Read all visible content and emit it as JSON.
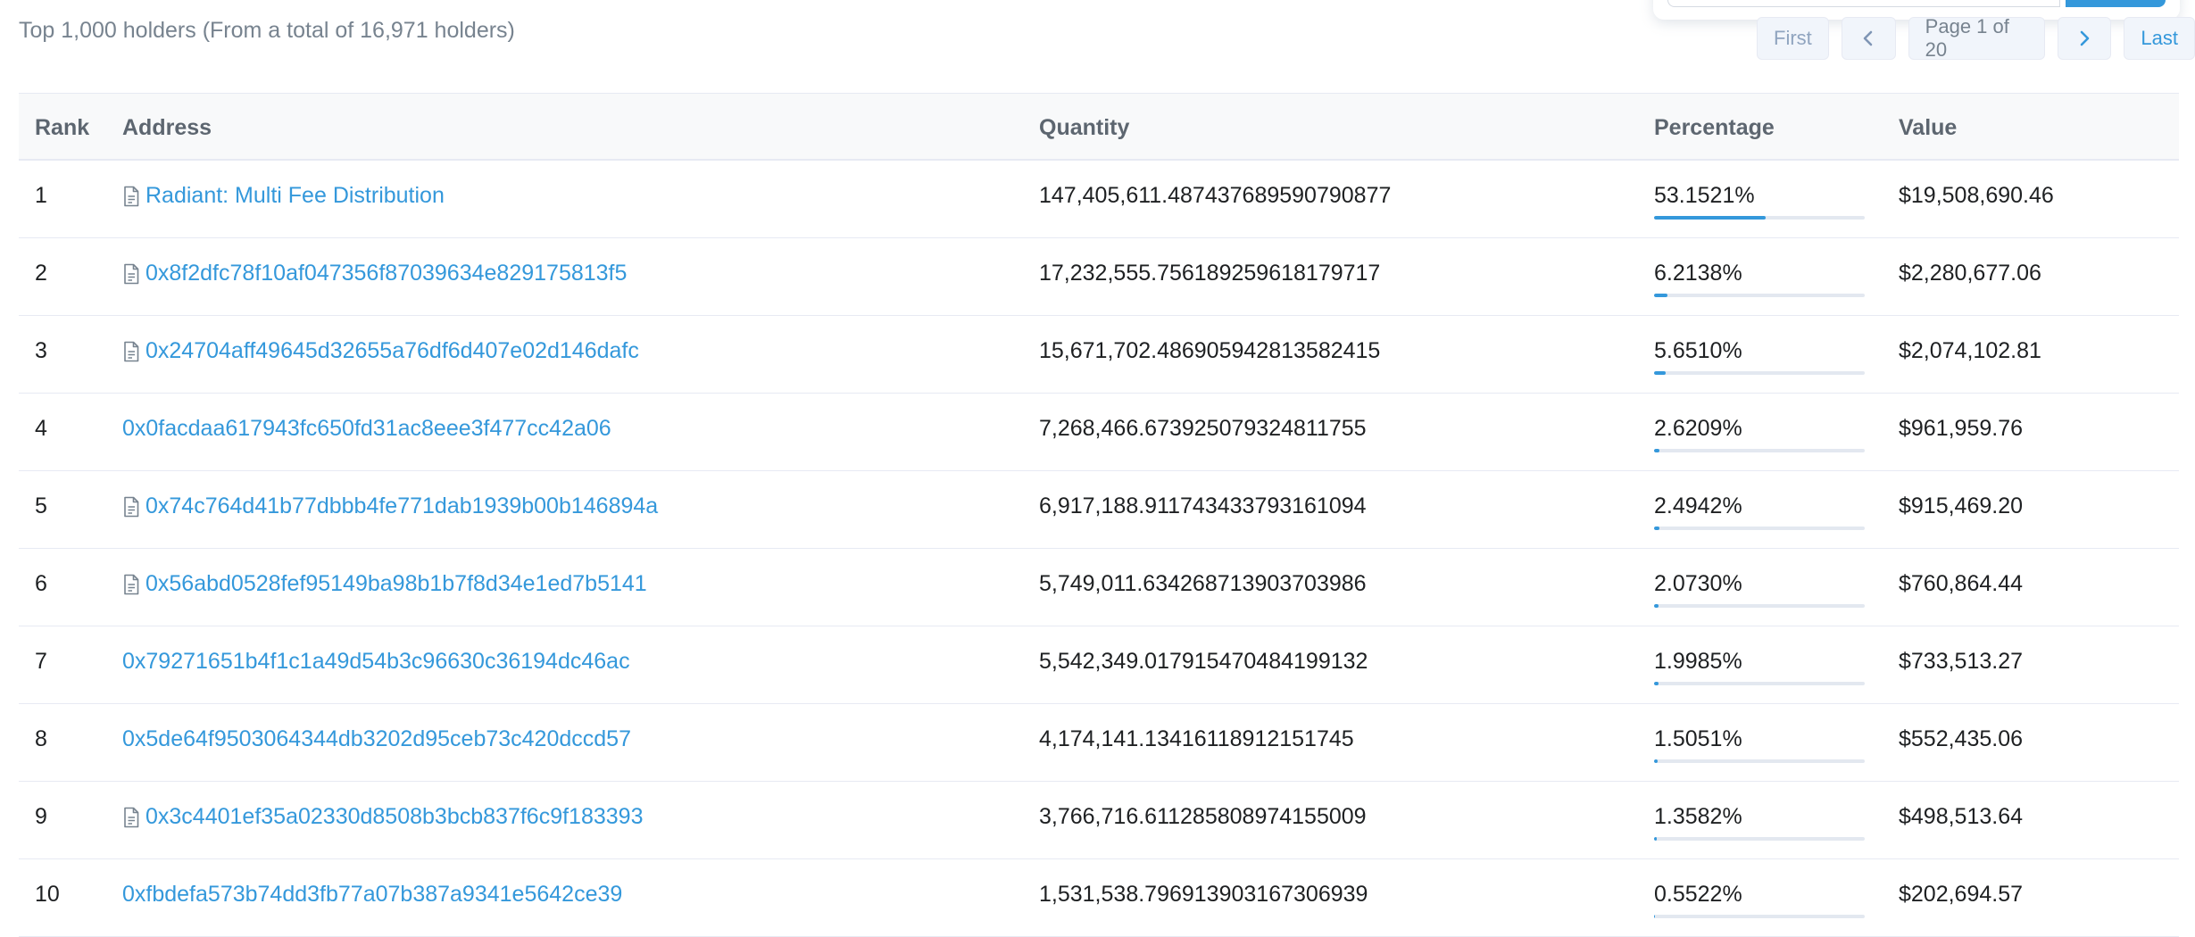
{
  "summary": "Top 1,000 holders (From a total of 16,971 holders)",
  "pager": {
    "first": "First",
    "page": "Page 1 of 20",
    "last": "Last"
  },
  "colors": {
    "accent": "#3498db",
    "track": "#e3e8f0",
    "muted": "#77838f"
  },
  "table": {
    "headers": {
      "rank": "Rank",
      "address": "Address",
      "quantity": "Quantity",
      "percentage": "Percentage",
      "value": "Value"
    },
    "rows": [
      {
        "rank": "1",
        "address": "Radiant: Multi Fee Distribution",
        "contract": true,
        "quantity": "147,405,611.487437689590790877",
        "percentage": "53.1521%",
        "pct_value": 53.1521,
        "value": "$19,508,690.46"
      },
      {
        "rank": "2",
        "address": "0x8f2dfc78f10af047356f87039634e829175813f5",
        "contract": true,
        "quantity": "17,232,555.756189259618179717",
        "percentage": "6.2138%",
        "pct_value": 6.2138,
        "value": "$2,280,677.06"
      },
      {
        "rank": "3",
        "address": "0x24704aff49645d32655a76df6d407e02d146dafc",
        "contract": true,
        "quantity": "15,671,702.486905942813582415",
        "percentage": "5.6510%",
        "pct_value": 5.651,
        "value": "$2,074,102.81"
      },
      {
        "rank": "4",
        "address": "0x0facdaa617943fc650fd31ac8eee3f477cc42a06",
        "contract": false,
        "quantity": "7,268,466.673925079324811755",
        "percentage": "2.6209%",
        "pct_value": 2.6209,
        "value": "$961,959.76"
      },
      {
        "rank": "5",
        "address": "0x74c764d41b77dbbb4fe771dab1939b00b146894a",
        "contract": true,
        "quantity": "6,917,188.911743433793161094",
        "percentage": "2.4942%",
        "pct_value": 2.4942,
        "value": "$915,469.20"
      },
      {
        "rank": "6",
        "address": "0x56abd0528fef95149ba98b1b7f8d34e1ed7b5141",
        "contract": true,
        "quantity": "5,749,011.634268713903703986",
        "percentage": "2.0730%",
        "pct_value": 2.073,
        "value": "$760,864.44"
      },
      {
        "rank": "7",
        "address": "0x79271651b4f1c1a49d54b3c96630c36194dc46ac",
        "contract": false,
        "quantity": "5,542,349.017915470484199132",
        "percentage": "1.9985%",
        "pct_value": 1.9985,
        "value": "$733,513.27"
      },
      {
        "rank": "8",
        "address": "0x5de64f9503064344db3202d95ceb73c420dccd57",
        "contract": false,
        "quantity": "4,174,141.13416118912151745",
        "percentage": "1.5051%",
        "pct_value": 1.5051,
        "value": "$552,435.06"
      },
      {
        "rank": "9",
        "address": "0x3c4401ef35a02330d8508b3bcb837f6c9f183393",
        "contract": true,
        "quantity": "3,766,716.611285808974155009",
        "percentage": "1.3582%",
        "pct_value": 1.3582,
        "value": "$498,513.64"
      },
      {
        "rank": "10",
        "address": "0xfbdefa573b74dd3fb77a07b387a9341e5642ce39",
        "contract": false,
        "quantity": "1,531,538.796913903167306939",
        "percentage": "0.5522%",
        "pct_value": 0.5522,
        "value": "$202,694.57"
      }
    ]
  }
}
